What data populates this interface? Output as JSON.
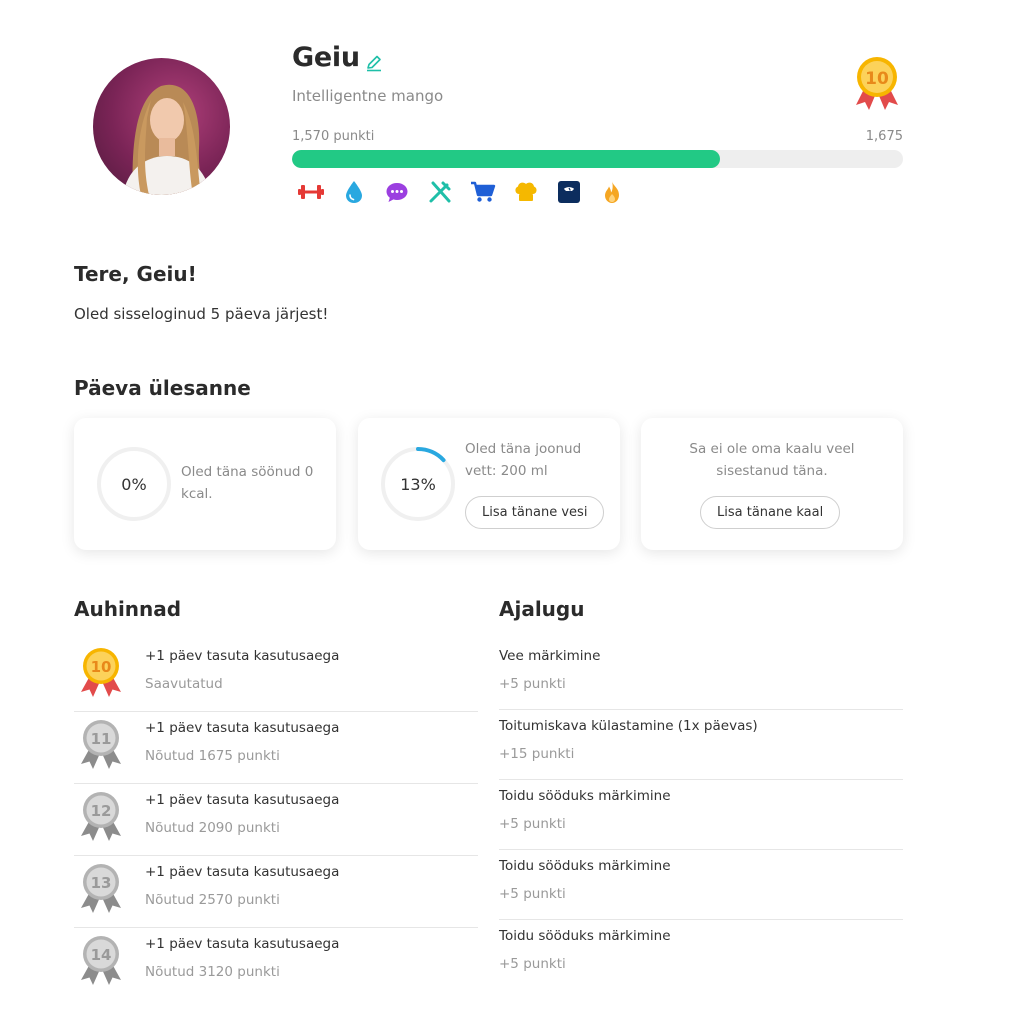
{
  "profile": {
    "name": "Geiu",
    "subtitle": "Intelligentne mango",
    "level": "10",
    "points_current_label": "1,570 punkti",
    "points_target_label": "1,675",
    "progress_fraction": 0.7,
    "progress_color": "#22c985",
    "badges": [
      {
        "icon": "dumbbell-icon",
        "color": "#e53935"
      },
      {
        "icon": "water-drop-icon",
        "color": "#29a8e0"
      },
      {
        "icon": "chat-bubble-icon",
        "color": "#9b3fe0"
      },
      {
        "icon": "utensils-icon",
        "color": "#1fbfa8"
      },
      {
        "icon": "shopping-cart-icon",
        "color": "#1f5fd6"
      },
      {
        "icon": "chef-hat-icon",
        "color": "#f5b800"
      },
      {
        "icon": "scale-icon",
        "color": "#0c2d5e"
      },
      {
        "icon": "flame-icon",
        "color": "#f5a623"
      }
    ]
  },
  "greeting": {
    "title": "Tere, Geiu!",
    "text": "Oled sisseloginud 5 päeva järjest!"
  },
  "daily_tasks": {
    "title": "Päeva ülesanne",
    "cards": [
      {
        "percent_label": "0%",
        "progress_fraction": 0.0,
        "text_line1": "Oled täna söönud 0",
        "text_line2": "kcal."
      },
      {
        "percent_label": "13%",
        "progress_fraction": 0.13,
        "text_line1": "Oled täna joonud",
        "text_line2": "vett: 200 ml",
        "button": "Lisa tänane vesi"
      },
      {
        "text_line1": "Sa ei ole oma kaalu veel",
        "text_line2": "sisestanud täna.",
        "button": "Lisa tänane kaal"
      }
    ],
    "ring_color": "#29a8e0"
  },
  "rewards": {
    "title": "Auhinnad",
    "items": [
      {
        "level": "10",
        "title": "+1 päev tasuta kasutusaega",
        "subtitle": "Saavutatud",
        "achieved": true
      },
      {
        "level": "11",
        "title": "+1 päev tasuta kasutusaega",
        "subtitle": "Nõutud 1675 punkti",
        "achieved": false
      },
      {
        "level": "12",
        "title": "+1 päev tasuta kasutusaega",
        "subtitle": "Nõutud 2090 punkti",
        "achieved": false
      },
      {
        "level": "13",
        "title": "+1 päev tasuta kasutusaega",
        "subtitle": "Nõutud 2570 punkti",
        "achieved": false
      },
      {
        "level": "14",
        "title": "+1 päev tasuta kasutusaega",
        "subtitle": "Nõutud 3120 punkti",
        "achieved": false
      }
    ]
  },
  "history": {
    "title": "Ajalugu",
    "items": [
      {
        "title": "Vee märkimine",
        "points": "+5 punkti"
      },
      {
        "title": "Toitumiskava külastamine (1x päevas)",
        "points": "+15 punkti"
      },
      {
        "title": "Toidu sööduks märkimine",
        "points": "+5 punkti"
      },
      {
        "title": "Toidu sööduks märkimine",
        "points": "+5 punkti"
      },
      {
        "title": "Toidu sööduks märkimine",
        "points": "+5 punkti"
      }
    ]
  }
}
